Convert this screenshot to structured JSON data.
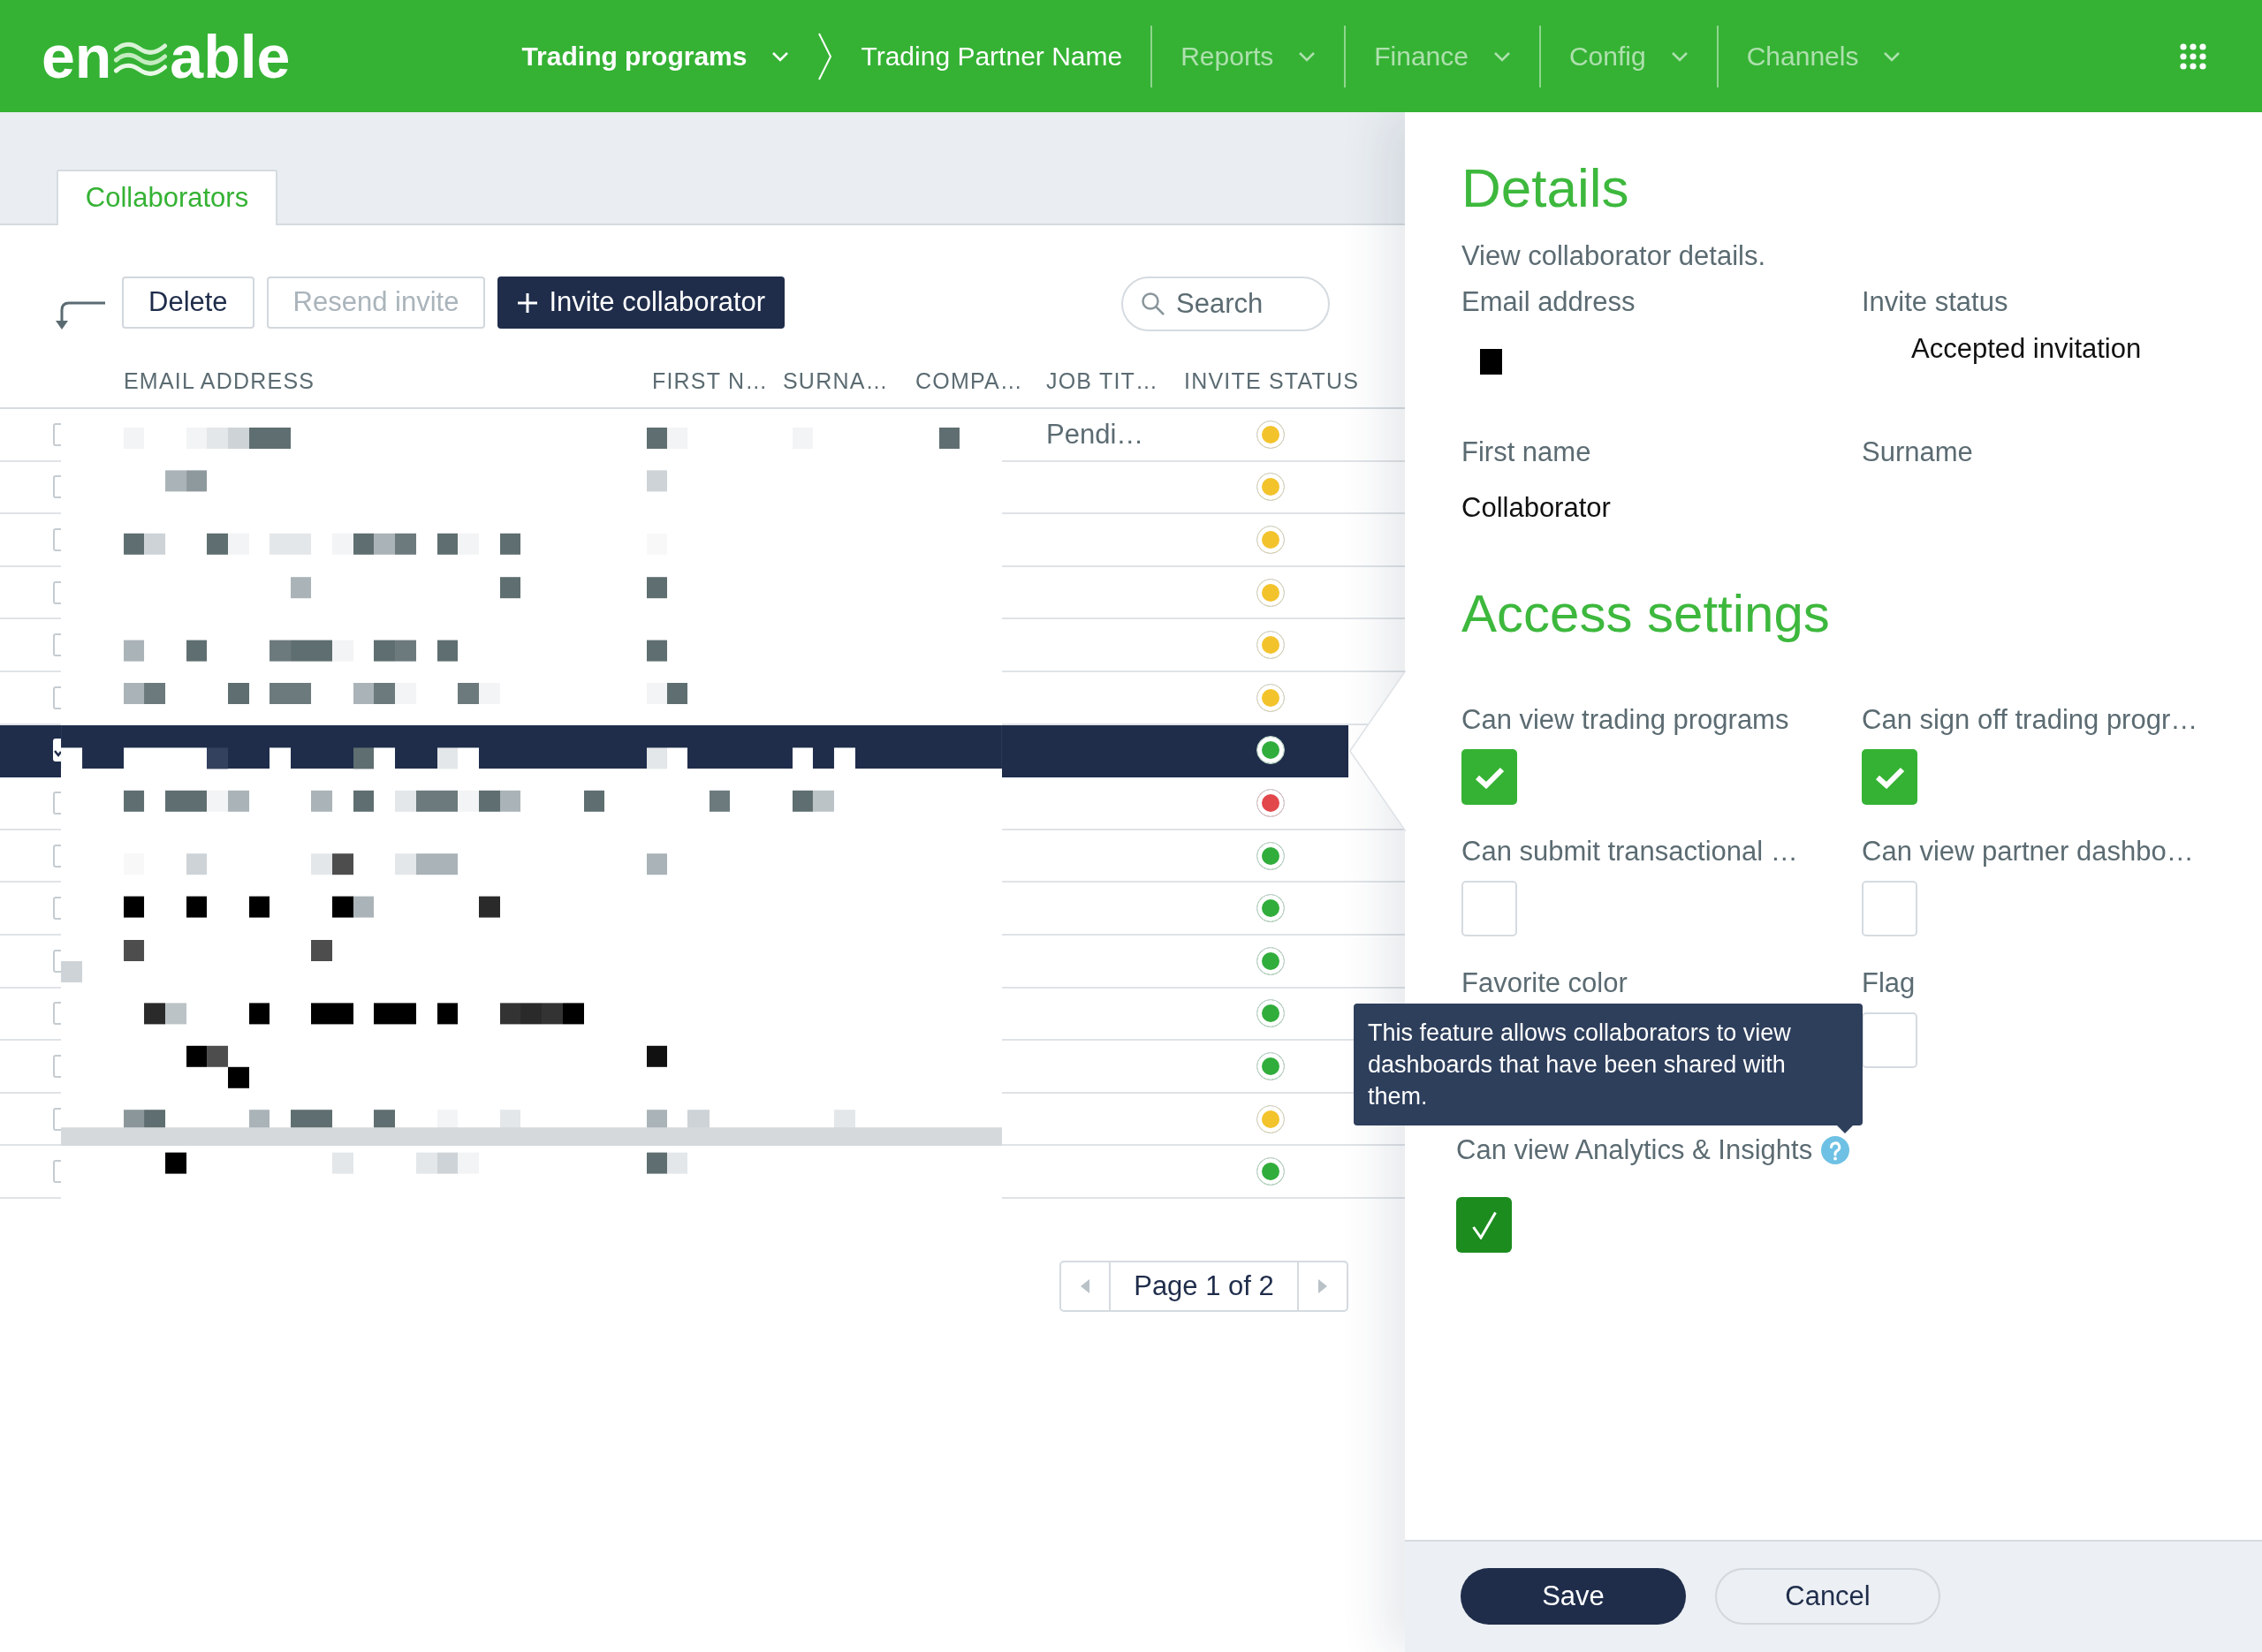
{
  "header": {
    "logo": {
      "left": "en",
      "right": "able"
    },
    "nav": [
      {
        "kind": "section",
        "label": "Trading programs",
        "disabled": false
      },
      {
        "kind": "crumb",
        "label": "Trading Partner Name",
        "disabled": false
      },
      {
        "kind": "menu",
        "label": "Reports",
        "disabled": true
      },
      {
        "kind": "menu",
        "label": "Finance",
        "disabled": true
      },
      {
        "kind": "menu",
        "label": "Config",
        "disabled": true
      },
      {
        "kind": "menu",
        "label": "Channels",
        "disabled": true
      }
    ]
  },
  "tabs": [
    {
      "label": "Collaborators",
      "selected": true
    }
  ],
  "toolbar": {
    "buttons": [
      {
        "kind": "outline",
        "label": "Delete",
        "disabled": false
      },
      {
        "kind": "outline",
        "label": "Resend invite",
        "disabled": true
      },
      {
        "kind": "primary",
        "label": "Invite collaborator",
        "disabled": false
      }
    ],
    "search": {
      "placeholder": "Search"
    }
  },
  "table": {
    "columns": [
      "EMAIL ADDRESS",
      "FIRST N…",
      "SURNA…",
      "COMPA…",
      "JOB TIT…",
      "INVITE STATUS"
    ],
    "rows": [
      {
        "selected": false,
        "checked": false,
        "job_title": "Pendi…",
        "color": "#f3c32c"
      },
      {
        "selected": false,
        "checked": false,
        "color": "#f3c32c"
      },
      {
        "selected": false,
        "checked": false,
        "color": "#f3c32c"
      },
      {
        "selected": false,
        "checked": false,
        "color": "#f3c32c"
      },
      {
        "selected": false,
        "checked": false,
        "color": "#f3c32c"
      },
      {
        "selected": false,
        "checked": false,
        "color": "#f3c32c"
      },
      {
        "selected": true,
        "checked": true,
        "color": "#31ad3c"
      },
      {
        "selected": false,
        "checked": false,
        "color": "#e2474c"
      },
      {
        "selected": false,
        "checked": false,
        "color": "#31ad3c"
      },
      {
        "selected": false,
        "checked": false,
        "color": "#31ad3c"
      },
      {
        "selected": false,
        "checked": false,
        "color": "#31ad3c"
      },
      {
        "selected": false,
        "checked": false,
        "color": "#31ad3c"
      },
      {
        "selected": false,
        "checked": false,
        "color": "#31ad3c"
      },
      {
        "selected": false,
        "checked": false,
        "color": "#f3c32c"
      },
      {
        "selected": false,
        "checked": false,
        "color": "#31ad3c"
      }
    ]
  },
  "pagination": {
    "label": "Page 1 of 2"
  },
  "details": {
    "title": "Details",
    "subtitle": "View collaborator details.",
    "fields": [
      {
        "label": "Email address",
        "kind": "redacted"
      },
      {
        "label": "Invite status",
        "kind": "status",
        "value": "Accepted invitation"
      },
      {
        "label": "First name",
        "kind": "text",
        "value": "Collaborator"
      },
      {
        "label": "Surname",
        "kind": "text"
      }
    ]
  },
  "access_settings": {
    "title": "Access settings",
    "options": [
      {
        "label": "Can view trading programs",
        "checked": true,
        "focused": false
      },
      {
        "label": "Can sign off trading progr…",
        "checked": true,
        "focused": false
      },
      {
        "label": "Can submit transactional …",
        "checked": false,
        "focused": false
      },
      {
        "label": "Can view partner dashbo…",
        "checked": false,
        "focused": false
      },
      {
        "label": "Favorite color"
      },
      {
        "label": "Flag",
        "checked": false,
        "focused": false
      },
      {
        "label": "Can view Analytics & Insights",
        "checked": true,
        "focused": true,
        "help": true,
        "tooltip": "This feature allows collaborators to view dashboards that have been shared with them."
      }
    ]
  },
  "footer": {
    "buttons": [
      {
        "kind": "primary",
        "label": "Save"
      },
      {
        "kind": "secondary",
        "label": "Cancel"
      }
    ]
  }
}
